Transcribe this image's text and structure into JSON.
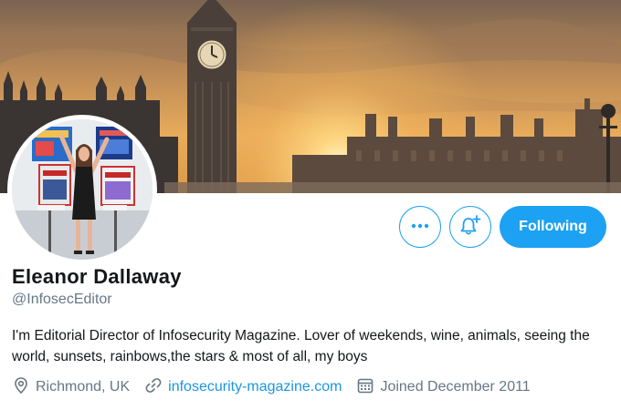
{
  "profile": {
    "display_name": "Eleanor Dallaway",
    "handle": "@InfosecEditor",
    "bio": "I'm Editorial Director of Infosecurity Magazine. Lover of weekends, wine, animals, seeing the world, sunsets, rainbows,the stars & most of all, my boys",
    "location": "Richmond, UK",
    "website": "infosecurity-magazine.com",
    "joined": "Joined December 2011"
  },
  "actions": {
    "following_label": "Following",
    "more_icon": "more-horizontal-icon",
    "bell_icon": "notification-bell-add-icon"
  },
  "colors": {
    "accent": "#1da1f2",
    "link": "#1b95e0",
    "secondary_text": "#657786",
    "primary_text": "#14171a"
  }
}
